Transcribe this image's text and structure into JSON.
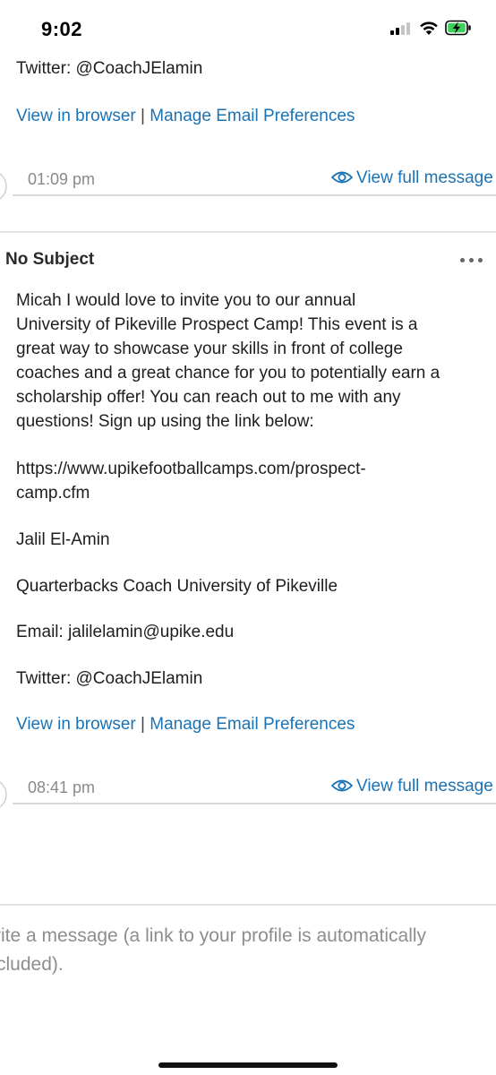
{
  "status_bar": {
    "time": "9:02"
  },
  "thread": {
    "previous_message": {
      "twitter": "Twitter: @CoachJElamin",
      "view_in_browser": "View in browser",
      "separator": "|",
      "manage_preferences": "Manage Email Preferences",
      "timestamp": "01:09 pm",
      "view_full_message": "View full message"
    },
    "message": {
      "subject": "No Subject",
      "body_lines": [
        "Micah I would love to invite you to our annual",
        "University of Pikeville Prospect Camp! This event is a",
        "great way to showcase your skills in front of college",
        "coaches and a great chance for you to potentially earn a",
        "scholarship offer! You can reach out to me with any",
        "questions! Sign up using the link below:"
      ],
      "url_lines": [
        "https://www.upikefootballcamps.com/prospect-",
        "camp.cfm"
      ],
      "signature_name": "Jalil El-Amin",
      "signature_title": "Quarterbacks Coach University of Pikeville",
      "email": "Email: jalilelamin@upike.edu",
      "twitter": "Twitter: @CoachJElamin",
      "view_in_browser": "View in browser",
      "separator": "|",
      "manage_preferences": "Manage Email Preferences",
      "timestamp": "08:41 pm",
      "view_full_message": "View full message"
    }
  },
  "compose": {
    "placeholder_line1": "rite a message (a link to your profile is automatically",
    "placeholder_line2": "cluded)."
  },
  "colors": {
    "link": "#1a73b5",
    "timestamp": "#8a8a8a",
    "avatar_accent": "#2b7fc0"
  },
  "icons": [
    "signal-icon",
    "wifi-icon",
    "battery-charging-icon",
    "eye-icon",
    "more-options-icon",
    "avatar-logo-icon"
  ]
}
